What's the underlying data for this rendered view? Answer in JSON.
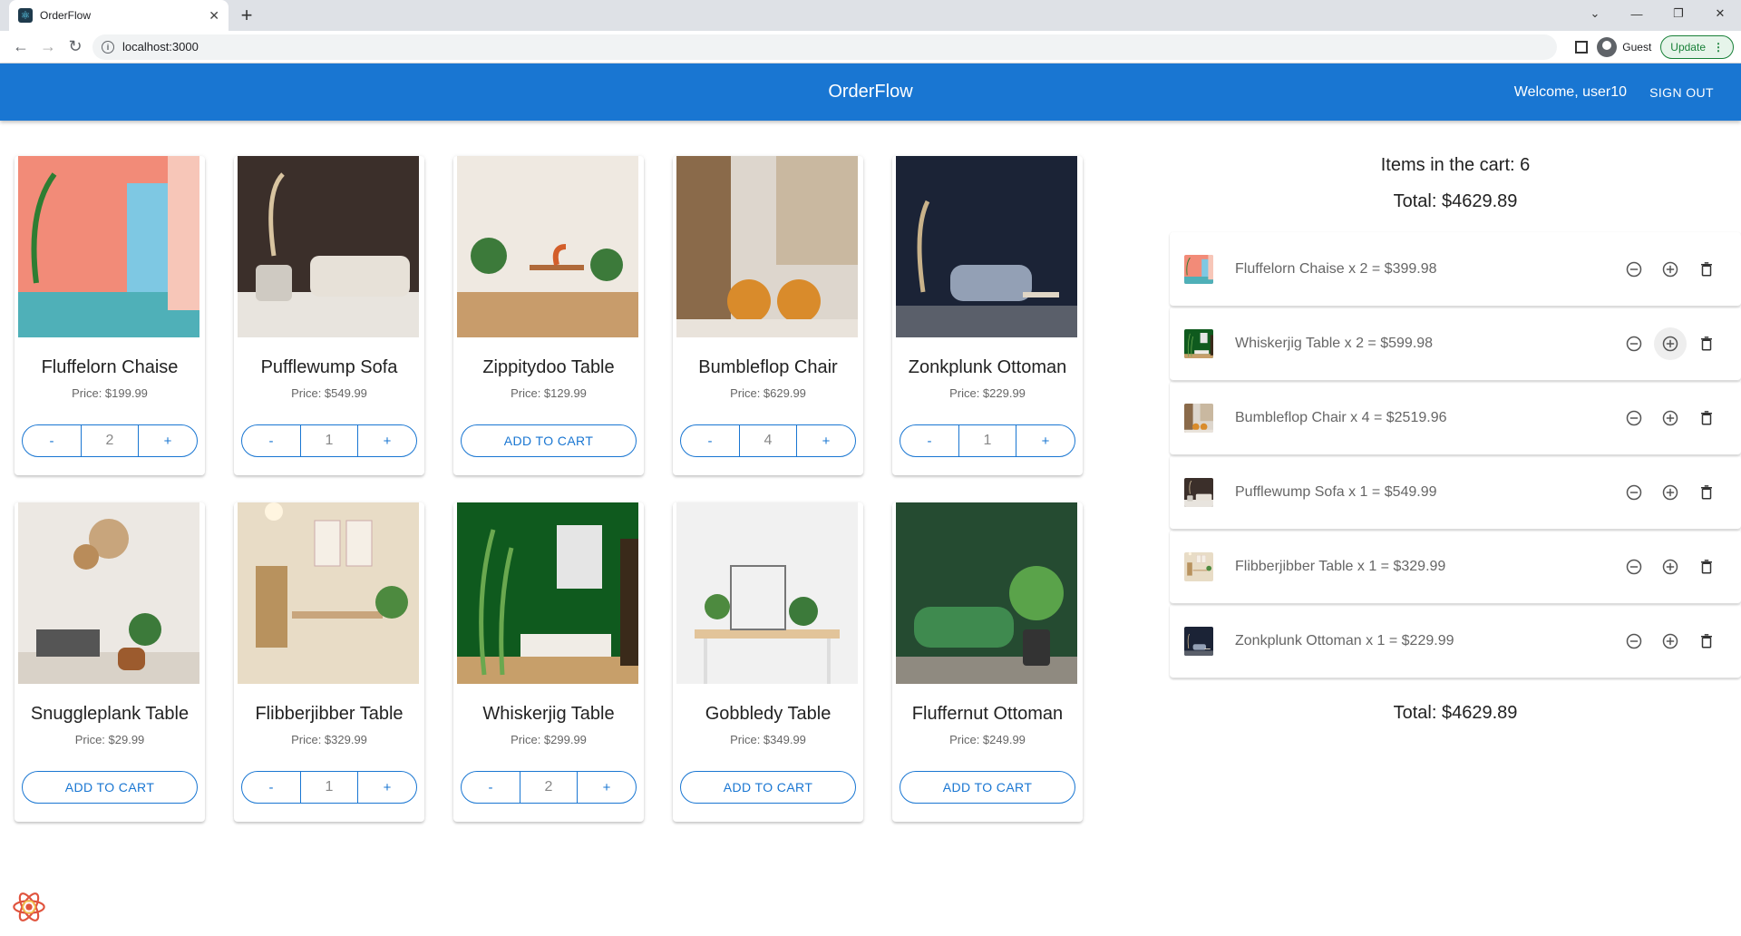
{
  "browser": {
    "tab_title": "OrderFlow",
    "url": "localhost:3000",
    "profile": "Guest",
    "update_label": "Update"
  },
  "app": {
    "title": "OrderFlow",
    "welcome": "Welcome, user10",
    "signout": "SIGN OUT"
  },
  "products": [
    {
      "name": "Fluffelorn Chaise",
      "price": "Price: $199.99",
      "qty": "2",
      "in_cart": true
    },
    {
      "name": "Pufflewump Sofa",
      "price": "Price: $549.99",
      "qty": "1",
      "in_cart": true
    },
    {
      "name": "Zippitydoo Table",
      "price": "Price: $129.99",
      "qty": "",
      "in_cart": false
    },
    {
      "name": "Bumbleflop Chair",
      "price": "Price: $629.99",
      "qty": "4",
      "in_cart": true
    },
    {
      "name": "Zonkplunk Ottoman",
      "price": "Price: $229.99",
      "qty": "1",
      "in_cart": true
    },
    {
      "name": "Snuggleplank Table",
      "price": "Price: $29.99",
      "qty": "",
      "in_cart": false
    },
    {
      "name": "Flibberjibber Table",
      "price": "Price: $329.99",
      "qty": "1",
      "in_cart": true
    },
    {
      "name": "Whiskerjig Table",
      "price": "Price: $299.99",
      "qty": "2",
      "in_cart": true
    },
    {
      "name": "Gobbledy Table",
      "price": "Price: $349.99",
      "qty": "",
      "in_cart": false
    },
    {
      "name": "Fluffernut Ottoman",
      "price": "Price: $249.99",
      "qty": "",
      "in_cart": false
    }
  ],
  "labels": {
    "add_to_cart": "ADD TO CART",
    "minus": "-",
    "plus": "+"
  },
  "cart": {
    "count_text": "Items in the cart: 6",
    "total_text": "Total: $4629.89",
    "items": [
      {
        "text": "Fluffelorn Chaise x 2 = $399.98"
      },
      {
        "text": "Whiskerjig Table x 2 = $599.98"
      },
      {
        "text": "Bumbleflop Chair x 4 = $2519.96"
      },
      {
        "text": "Pufflewump Sofa x 1 = $549.99"
      },
      {
        "text": "Flibberjibber Table x 1 = $329.99"
      },
      {
        "text": "Zonkplunk Ottoman x 1 = $229.99"
      }
    ]
  },
  "colors": {
    "primary": "#1976d2",
    "appbar": "#1976d2"
  }
}
